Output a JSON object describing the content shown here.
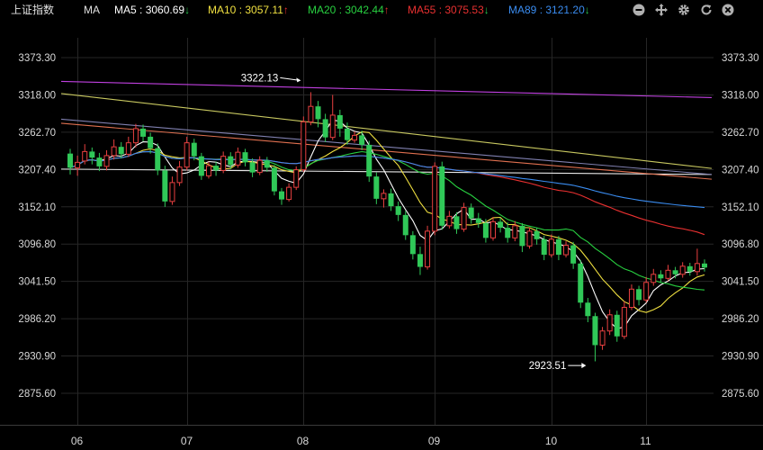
{
  "header": {
    "index_name": "上证指数",
    "indicator": "MA",
    "ma": [
      {
        "label": "MA5",
        "value": "3060.69",
        "dir": "down",
        "arrow": "↓",
        "color": "#ffffff"
      },
      {
        "label": "MA10",
        "value": "3057.11",
        "dir": "up",
        "arrow": "↑",
        "color": "#f0e040"
      },
      {
        "label": "MA20",
        "value": "3042.44",
        "dir": "up",
        "arrow": "↑",
        "color": "#28d040"
      },
      {
        "label": "MA55",
        "value": "3075.53",
        "dir": "down",
        "arrow": "↓",
        "color": "#e83030"
      },
      {
        "label": "MA89",
        "value": "3121.20",
        "dir": "down",
        "arrow": "↓",
        "color": "#3a8cf0"
      }
    ],
    "toolbar_icons": [
      "minus-circle-icon",
      "move-icon",
      "gear-icon",
      "refresh-icon",
      "close-icon"
    ]
  },
  "colors": {
    "up": "#e84040",
    "down": "#30c858",
    "arrow_up": "#e83030",
    "arrow_down": "#28c850",
    "grid": "#262626",
    "axis_text": "#d8d8d8",
    "line_200": "#c040e0",
    "line_120": "#c8c860",
    "line_250": "#e8e8e8"
  },
  "chart_data": {
    "type": "candlestick",
    "y_ticks": [
      "3373.30",
      "3318.00",
      "3262.70",
      "3207.40",
      "3152.10",
      "3096.80",
      "3041.50",
      "2986.20",
      "2930.90",
      "2875.60"
    ],
    "ylim": [
      2875.6,
      3373.3
    ],
    "x_labels": [
      {
        "label": "06",
        "index": 1
      },
      {
        "label": "07",
        "index": 16
      },
      {
        "label": "08",
        "index": 32
      },
      {
        "label": "09",
        "index": 50
      },
      {
        "label": "10",
        "index": 66
      },
      {
        "label": "11",
        "index": 79
      }
    ],
    "annotations": [
      {
        "label": "3322.13",
        "value": 3322.13,
        "index": 32,
        "type": "high"
      },
      {
        "label": "2923.51",
        "value": 2923.51,
        "index": 71,
        "type": "low"
      }
    ],
    "candles": [
      [
        3231,
        3210,
        3238,
        3200
      ],
      [
        3210,
        3218,
        3228,
        3198
      ],
      [
        3220,
        3234,
        3245,
        3215
      ],
      [
        3234,
        3225,
        3240,
        3215
      ],
      [
        3225,
        3212,
        3232,
        3205
      ],
      [
        3212,
        3228,
        3236,
        3206
      ],
      [
        3228,
        3241,
        3252,
        3222
      ],
      [
        3241,
        3230,
        3248,
        3224
      ],
      [
        3230,
        3247,
        3256,
        3226
      ],
      [
        3247,
        3268,
        3275,
        3240
      ],
      [
        3268,
        3256,
        3274,
        3249
      ],
      [
        3256,
        3239,
        3262,
        3231
      ],
      [
        3239,
        3206,
        3246,
        3199
      ],
      [
        3206,
        3160,
        3213,
        3152
      ],
      [
        3160,
        3188,
        3197,
        3155
      ],
      [
        3188,
        3211,
        3220,
        3183
      ],
      [
        3211,
        3247,
        3256,
        3206
      ],
      [
        3247,
        3227,
        3253,
        3221
      ],
      [
        3227,
        3198,
        3232,
        3192
      ],
      [
        3198,
        3213,
        3219,
        3194
      ],
      [
        3213,
        3206,
        3219,
        3198
      ],
      [
        3206,
        3227,
        3234,
        3202
      ],
      [
        3227,
        3214,
        3233,
        3208
      ],
      [
        3214,
        3233,
        3240,
        3210
      ],
      [
        3233,
        3218,
        3238,
        3212
      ],
      [
        3218,
        3203,
        3224,
        3196
      ],
      [
        3203,
        3221,
        3227,
        3199
      ],
      [
        3221,
        3210,
        3226,
        3204
      ],
      [
        3210,
        3175,
        3214,
        3169
      ],
      [
        3175,
        3163,
        3180,
        3155
      ],
      [
        3163,
        3181,
        3187,
        3160
      ],
      [
        3181,
        3207,
        3212,
        3177
      ],
      [
        3207,
        3278,
        3286,
        3204
      ],
      [
        3278,
        3301,
        3322,
        3273
      ],
      [
        3301,
        3282,
        3309,
        3270
      ],
      [
        3282,
        3255,
        3290,
        3248
      ],
      [
        3255,
        3288,
        3318,
        3251
      ],
      [
        3288,
        3268,
        3296,
        3256
      ],
      [
        3268,
        3251,
        3277,
        3244
      ],
      [
        3251,
        3258,
        3264,
        3247
      ],
      [
        3258,
        3244,
        3265,
        3236
      ],
      [
        3244,
        3197,
        3250,
        3189
      ],
      [
        3197,
        3164,
        3203,
        3156
      ],
      [
        3164,
        3172,
        3178,
        3151
      ],
      [
        3172,
        3153,
        3179,
        3146
      ],
      [
        3153,
        3140,
        3160,
        3131
      ],
      [
        3140,
        3110,
        3146,
        3103
      ],
      [
        3110,
        3082,
        3116,
        3074
      ],
      [
        3082,
        3063,
        3093,
        3051
      ],
      [
        3063,
        3116,
        3124,
        3059
      ],
      [
        3116,
        3212,
        3218,
        3110
      ],
      [
        3212,
        3124,
        3219,
        3118
      ],
      [
        3124,
        3138,
        3146,
        3120
      ],
      [
        3138,
        3119,
        3144,
        3112
      ],
      [
        3119,
        3151,
        3158,
        3115
      ],
      [
        3151,
        3135,
        3157,
        3127
      ],
      [
        3135,
        3128,
        3143,
        3121
      ],
      [
        3128,
        3106,
        3134,
        3099
      ],
      [
        3106,
        3130,
        3137,
        3102
      ],
      [
        3130,
        3121,
        3136,
        3114
      ],
      [
        3121,
        3106,
        3129,
        3099
      ],
      [
        3106,
        3124,
        3131,
        3101
      ],
      [
        3124,
        3094,
        3128,
        3085
      ],
      [
        3094,
        3116,
        3122,
        3090
      ],
      [
        3116,
        3104,
        3121,
        3096
      ],
      [
        3104,
        3081,
        3109,
        3073
      ],
      [
        3081,
        3104,
        3111,
        3077
      ],
      [
        3104,
        3081,
        3109,
        3073
      ],
      [
        3081,
        3095,
        3101,
        3077
      ],
      [
        3095,
        3068,
        3100,
        3060
      ],
      [
        3068,
        3010,
        3073,
        3002
      ],
      [
        3010,
        2990,
        3017,
        2981
      ],
      [
        2990,
        2947,
        2995,
        2923
      ],
      [
        2947,
        2968,
        2974,
        2940
      ],
      [
        2968,
        2992,
        3000,
        2962
      ],
      [
        2992,
        2960,
        2998,
        2952
      ],
      [
        2960,
        3003,
        3012,
        2956
      ],
      [
        3003,
        3030,
        3037,
        2999
      ],
      [
        3030,
        3014,
        3035,
        3006
      ],
      [
        3014,
        3040,
        3048,
        3010
      ],
      [
        3040,
        3052,
        3060,
        3035
      ],
      [
        3052,
        3046,
        3058,
        3040
      ],
      [
        3046,
        3058,
        3066,
        3042
      ],
      [
        3058,
        3052,
        3063,
        3046
      ],
      [
        3052,
        3064,
        3070,
        3047
      ],
      [
        3064,
        3056,
        3069,
        3050
      ],
      [
        3056,
        3068,
        3090,
        3050
      ],
      [
        3068,
        3062,
        3074,
        3056
      ]
    ],
    "ma_lines": [
      {
        "name": "MA5",
        "period": 5,
        "color": "#ffffff"
      },
      {
        "name": "MA10",
        "period": 10,
        "color": "#f0e040"
      },
      {
        "name": "MA20",
        "period": 20,
        "color": "#28d040"
      },
      {
        "name": "MA55",
        "period": 55,
        "color": "#e83030"
      },
      {
        "name": "MA89",
        "period": 89,
        "color": "#3a8cf0"
      }
    ],
    "long_lines": [
      {
        "start": 3338,
        "end": 3314,
        "color": "#c040e0"
      },
      {
        "start": 3320,
        "end": 3209,
        "color": "#c8c860"
      },
      {
        "start": 3208,
        "end": 3200,
        "color": "#e8e8e8"
      },
      {
        "start": 3276,
        "end": 3193,
        "color": "#e07050"
      },
      {
        "start": 3282,
        "end": 3200,
        "color": "#8080b0"
      }
    ]
  }
}
